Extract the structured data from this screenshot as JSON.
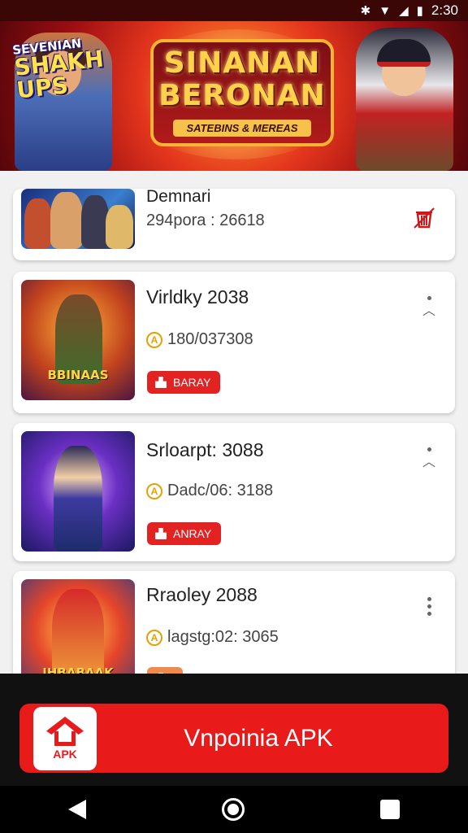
{
  "status_bar": {
    "time": "2:30",
    "icons": [
      "bluetooth-icon",
      "wifi-icon",
      "signal-icon",
      "battery-icon"
    ]
  },
  "banner": {
    "left_title_line1": "SEVENIAN",
    "left_title_line2": "SHAKH UPS",
    "title_line1": "SINANAN",
    "title_line2": "BERONAN",
    "subtitle": "SATEBINS & MEREAS"
  },
  "games": [
    {
      "title": "Demnari",
      "meta": "294pora : 26618",
      "tag": "",
      "action_icon": "trash-icon",
      "thumb_text": ""
    },
    {
      "title": "Virldky  2038",
      "meta": "180/037308",
      "tag": "BARAY",
      "action_icon": "more-vert-icon",
      "thumb_text": "BBINAAS"
    },
    {
      "title": "Srloarpt: 3088",
      "meta": "Dadc/06: 3188",
      "tag": "ANRAY",
      "action_icon": "more-vert-icon",
      "thumb_text": ""
    },
    {
      "title": "Rraoley  2088",
      "meta": "lagstg:02: 3065",
      "tag": "",
      "action_icon": "more-vert-icon",
      "thumb_text": "JHBABAAK"
    }
  ],
  "apk_button": {
    "logo_label": "APK",
    "label": "Vnpoinia APK"
  },
  "nav": {
    "items": [
      "back-icon",
      "home-icon",
      "recents-icon"
    ]
  },
  "colors": {
    "accent": "#e81a1a",
    "tag": "#e32222",
    "meta_icon": "#e5a100"
  }
}
